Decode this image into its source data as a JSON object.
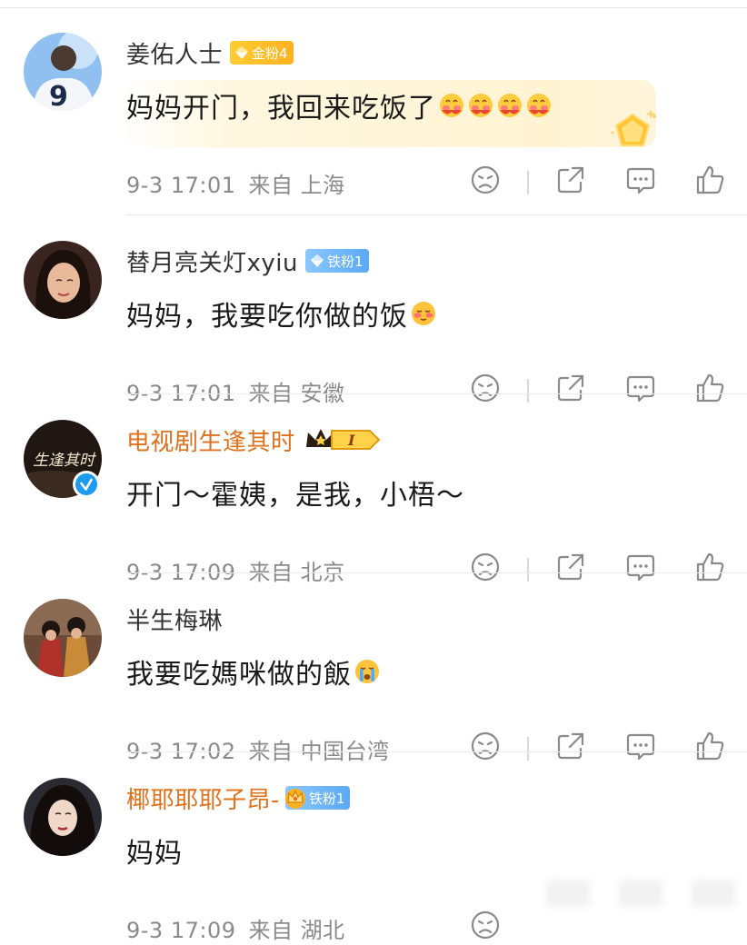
{
  "colors": {
    "username_default": "#333333",
    "username_highlight": "#e0701b",
    "meta": "#8a8a8a",
    "gold_badge": "#ffb21e",
    "iron_badge": "#5aa9f5",
    "verified": "#1d9bf0"
  },
  "comments": [
    {
      "username": "姜佑人士",
      "badge": {
        "type": "gold",
        "icon": "diamond-icon",
        "label": "金粉4"
      },
      "text": "妈妈开门，我回来吃饭了",
      "emojis": [
        "hug-face-icon",
        "hug-face-icon",
        "hug-face-icon",
        "hug-face-icon"
      ],
      "time": "9-3 17:01",
      "from": "来自",
      "location": "上海",
      "highlighted": true
    },
    {
      "username": "替月亮关灯xyiu",
      "badge": {
        "type": "iron",
        "icon": "diamond-icon",
        "label": "铁粉1"
      },
      "text": "妈妈，我要吃你做的饭",
      "emojis": [
        "blush-face-icon"
      ],
      "time": "9-3 17:01",
      "from": "来自",
      "location": "安徽"
    },
    {
      "username": "电视剧生逢其时",
      "badge": {
        "type": "crown",
        "icon": "crown-icon",
        "label": "I"
      },
      "text": "开门～霍姨，是我，小梧～",
      "emojis": [],
      "verified": true,
      "avatar_text": "生逢其时",
      "time": "9-3 17:09",
      "from": "来自",
      "location": "北京"
    },
    {
      "username": "半生梅琳",
      "text": "我要吃媽咪做的飯",
      "emojis": [
        "crying-face-icon"
      ],
      "time": "9-3 17:02",
      "from": "来自",
      "location": "中国台湾"
    },
    {
      "username": "椰耶耶耶子昂-",
      "badge": {
        "type": "iron",
        "icon": "crown-icon",
        "label": "铁粉1"
      },
      "text": "妈妈",
      "emojis": [],
      "time": "9-3 17:09",
      "from": "来自",
      "location": "湖北"
    }
  ],
  "actions": [
    "dislike-face-icon",
    "share-icon",
    "comment-icon",
    "like-thumb-icon"
  ]
}
